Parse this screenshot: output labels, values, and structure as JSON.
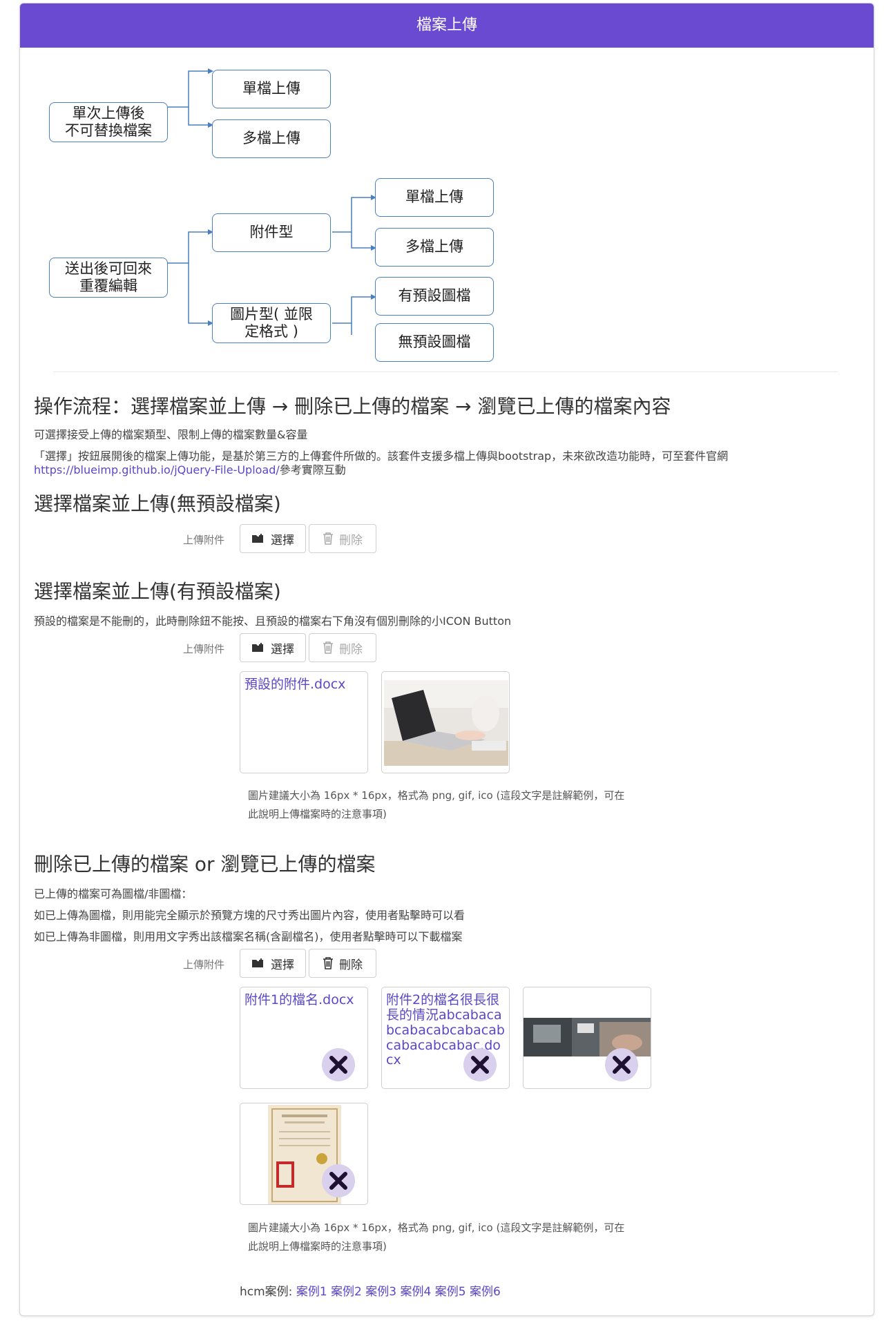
{
  "header": {
    "title": "檔案上傳"
  },
  "diagram": {
    "top_root": [
      "單次上傳後",
      "不可替換檔案"
    ],
    "top_children": [
      "單檔上傳",
      "多檔上傳"
    ],
    "bottom_root": [
      "送出後可回來",
      "重覆編輯"
    ],
    "attach_type": "附件型",
    "image_type": [
      "圖片型( 並限",
      "定格式 )"
    ],
    "attach_children": [
      "單檔上傳",
      "多檔上傳"
    ],
    "image_children": [
      "有預設圖檔",
      "無預設圖檔"
    ]
  },
  "section1": {
    "heading": "操作流程：選擇檔案並上傳 → 刪除已上傳的檔案 → 瀏覽已上傳的檔案內容",
    "line1": "可選擇接受上傳的檔案類型、限制上傳的檔案數量&容量",
    "line2": "「選擇」按鈕展開後的檔案上傳功能，是基於第三方的上傳套件所做的。該套件支援多檔上傳與bootstrap，未來欲改造功能時，可至套件官網",
    "link": "https://blueimp.github.io/jQuery-File-Upload/",
    "line3_suffix": "參考實際互動"
  },
  "section2": {
    "heading": "選擇檔案並上傳(無預設檔案)",
    "label": "上傳附件",
    "select": "選擇",
    "delete": "刪除"
  },
  "section3": {
    "heading": "選擇檔案並上傳(有預設檔案)",
    "desc": "預設的檔案是不能刪的，此時刪除鈕不能按、且預設的檔案右下角沒有個別刪除的小ICON Button",
    "label": "上傳附件",
    "select": "選擇",
    "delete": "刪除",
    "file1": "預設的附件.docx",
    "note1": "圖片建議大小為 16px * 16px，格式為 png, gif, ico (這段文字是註解範例，可在",
    "note2": "此說明上傳檔案時的注意事項)"
  },
  "section4": {
    "heading": "刪除已上傳的檔案 or 瀏覽已上傳的檔案",
    "line1": "已上傳的檔案可為圖檔/非圖檔：",
    "line2": "如已上傳為圖檔，則用能完全顯示於預覽方塊的尺寸秀出圖片內容，使用者點擊時可以看",
    "line3": "如已上傳為非圖檔，則用用文字秀出該檔案名稱(含副檔名)，使用者點擊時可以下載檔案",
    "label": "上傳附件",
    "select": "選擇",
    "delete": "刪除",
    "file1": "附件1的檔名.docx",
    "file2": "附件2的檔名很長很長的情況abcabacabcabacabcabacabcabacabcabac.docx",
    "note1": "圖片建議大小為 16px * 16px，格式為 png, gif, ico (這段文字是註解範例，可在",
    "note2": "此說明上傳檔案時的注意事項)"
  },
  "footer": {
    "prefix": "hcm案例:",
    "links": [
      "案例1",
      "案例2",
      "案例3",
      "案例4",
      "案例5",
      "案例6"
    ]
  },
  "colors": {
    "brand": "#6a4ad0",
    "link": "#5a47c8",
    "connector": "#4a7fc1"
  },
  "icons": {
    "select": "folder-plus-icon",
    "delete": "trash-icon",
    "remove": "close-icon"
  }
}
